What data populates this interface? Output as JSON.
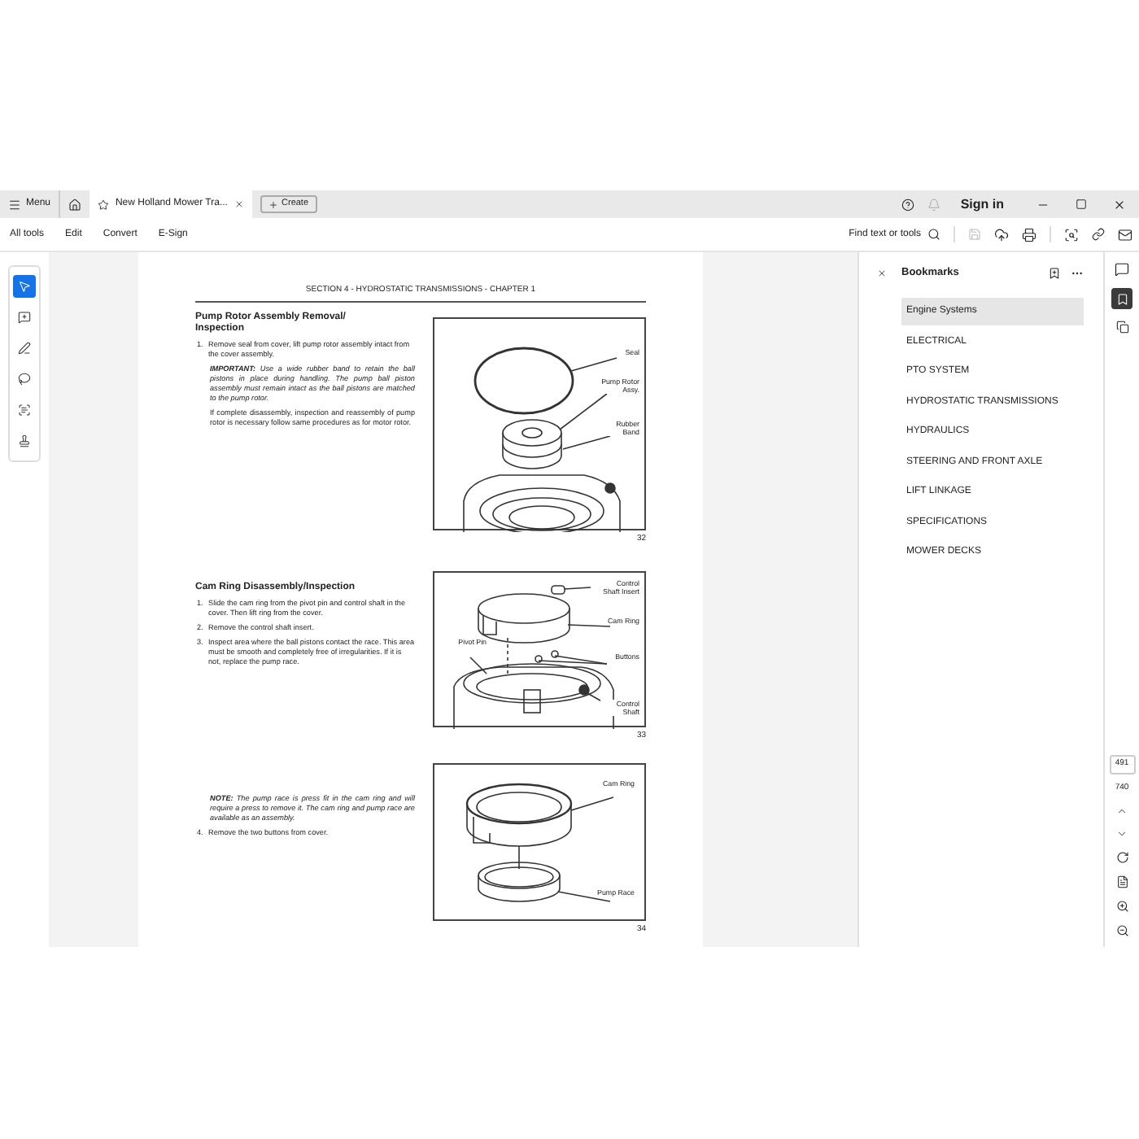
{
  "tab_bar": {
    "menu_label": "Menu",
    "tab_title": "New Holland Mower Tra...",
    "create_label": "Create",
    "sign_in": "Sign in"
  },
  "toolbar": {
    "items": [
      "All tools",
      "Edit",
      "Convert",
      "E-Sign"
    ],
    "search_label": "Find text or tools"
  },
  "tools": [
    {
      "kind": "select",
      "selected": true
    },
    {
      "kind": "comment",
      "selected": false
    },
    {
      "kind": "draw",
      "selected": false
    },
    {
      "kind": "lasso",
      "selected": false
    },
    {
      "kind": "text",
      "selected": false
    },
    {
      "kind": "stamp",
      "selected": false
    }
  ],
  "document": {
    "header": "SECTION 4 - HYDROSTATIC TRANSMISSIONS - CHAPTER 1",
    "rows": [
      {
        "blocks": [
          {
            "kind": "heading",
            "text": "Pump Rotor Assembly Removal/ Inspection"
          },
          {
            "kind": "step",
            "number": "1.",
            "text": "Remove seal from cover, lift pump rotor assembly intact from the cover assembly."
          },
          {
            "kind": "note",
            "text": "**IMPORTANT:** Use a wide rubber band to retain the ball pistons in place during handling. The pump ball piston assembly must remain intact as the ball pistons are matched to the pump rotor."
          },
          {
            "kind": "para",
            "text": "If complete disassembly, inspection and reassembly of pump rotor is necessary follow same procedures as for motor rotor."
          }
        ],
        "figure": {
          "labels": [
            "Seal",
            "Pump Rotor Assy.",
            "Rubber Band"
          ],
          "number": "32"
        }
      },
      {
        "blocks": [
          {
            "kind": "heading",
            "text": "Cam Ring Disassembly/Inspection"
          },
          {
            "kind": "step",
            "number": "1.",
            "text": "Slide the cam ring from the pivot pin and control shaft in the cover. Then lift ring from the cover."
          },
          {
            "kind": "step",
            "number": "2.",
            "text": "Remove the control shaft insert."
          },
          {
            "kind": "step",
            "number": "3.",
            "text": "Inspect area where the ball pistons contact the race. This area must be smooth and completely free of irregularities. If it is not, replace the pump race."
          }
        ],
        "figure": {
          "labels": [
            "Control Shaft Insert",
            "Cam Ring",
            "Pivot Pin",
            "Buttons",
            "Control Shaft"
          ],
          "number": "33"
        }
      },
      {
        "blocks": [
          {
            "kind": "note",
            "text": "**NOTE:** The pump race is press fit in the cam ring and will require a press to remove it. The cam ring and pump race are available as an assembly."
          },
          {
            "kind": "step",
            "number": "4.",
            "text": "Remove the two buttons from cover."
          }
        ],
        "figure": {
          "labels": [
            "Cam Ring",
            "Pump Race"
          ],
          "number": "34"
        }
      }
    ]
  },
  "bookmarks": {
    "title": "Bookmarks",
    "items": [
      {
        "label": "Engine Systems",
        "selected": true
      },
      {
        "label": "ELECTRICAL",
        "selected": false
      },
      {
        "label": "PTO SYSTEM",
        "selected": false
      },
      {
        "label": "HYDROSTATIC TRANSMISSIONS",
        "selected": false
      },
      {
        "label": "HYDRAULICS",
        "selected": false
      },
      {
        "label": "STEERING AND FRONT AXLE",
        "selected": false
      },
      {
        "label": "LIFT LINKAGE",
        "selected": false
      },
      {
        "label": "SPECIFICATIONS",
        "selected": false
      },
      {
        "label": "MOWER DECKS",
        "selected": false
      }
    ]
  },
  "page_nav": {
    "current": "491",
    "total": "740"
  }
}
